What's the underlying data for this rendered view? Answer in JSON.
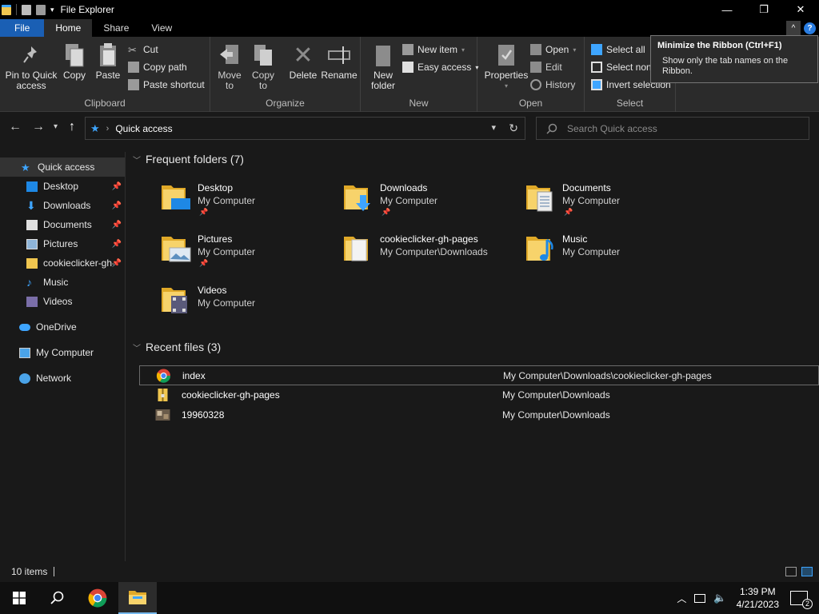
{
  "window": {
    "title": "File Explorer"
  },
  "controls": {
    "minimize": "—",
    "maximize": "❐",
    "close": "✕"
  },
  "tabs": [
    {
      "label": "File"
    },
    {
      "label": "Home"
    },
    {
      "label": "Share"
    },
    {
      "label": "View"
    }
  ],
  "ribbon": {
    "help": "?",
    "clipboard": {
      "label": "Clipboard",
      "pin": "Pin to Quick\naccess",
      "copy": "Copy",
      "paste": "Paste",
      "cut": "Cut",
      "copy_path": "Copy path",
      "paste_shortcut": "Paste shortcut"
    },
    "organize": {
      "label": "Organize",
      "move_to": "Move\nto",
      "copy_to": "Copy\nto",
      "delete": "Delete",
      "rename": "Rename"
    },
    "new": {
      "label": "New",
      "new_folder": "New\nfolder",
      "new_item": "New item",
      "easy_access": "Easy access"
    },
    "open": {
      "label": "Open",
      "properties": "Properties",
      "open": "Open",
      "edit": "Edit",
      "history": "History"
    },
    "select": {
      "label": "Select",
      "select_all": "Select all",
      "select_none": "Select non",
      "invert": "Invert selection"
    }
  },
  "tooltip": {
    "title": "Minimize the Ribbon (Ctrl+F1)",
    "body": "Show only the tab names on the Ribbon."
  },
  "address": {
    "path": "Quick access"
  },
  "search": {
    "placeholder": "Search Quick access"
  },
  "sidebar": {
    "items": [
      {
        "label": "Quick access",
        "icon": "star-icon"
      },
      {
        "label": "Desktop",
        "icon": "desktop-icon"
      },
      {
        "label": "Downloads",
        "icon": "download-icon"
      },
      {
        "label": "Documents",
        "icon": "document-icon"
      },
      {
        "label": "Pictures",
        "icon": "pictures-icon"
      },
      {
        "label": "cookieclicker-gh-pages",
        "icon": "folder-icon"
      },
      {
        "label": "Music",
        "icon": "music-icon"
      },
      {
        "label": "Videos",
        "icon": "videos-icon"
      },
      {
        "label": "OneDrive",
        "icon": "cloud-icon"
      },
      {
        "label": "My Computer",
        "icon": "computer-icon"
      },
      {
        "label": "Network",
        "icon": "network-icon"
      }
    ]
  },
  "frequent": {
    "title": "Frequent folders (7)",
    "folders": [
      {
        "name": "Desktop",
        "location": "My Computer"
      },
      {
        "name": "Downloads",
        "location": "My Computer"
      },
      {
        "name": "Documents",
        "location": "My Computer"
      },
      {
        "name": "Pictures",
        "location": "My Computer"
      },
      {
        "name": "cookieclicker-gh-pages",
        "location": "My Computer\\Downloads"
      },
      {
        "name": "Music",
        "location": "My Computer"
      },
      {
        "name": "Videos",
        "location": "My Computer"
      }
    ]
  },
  "recent": {
    "title": "Recent files (3)",
    "files": [
      {
        "name": "index",
        "location": "My Computer\\Downloads\\cookieclicker-gh-pages"
      },
      {
        "name": "cookieclicker-gh-pages",
        "location": "My Computer\\Downloads"
      },
      {
        "name": "19960328",
        "location": "My Computer\\Downloads"
      }
    ]
  },
  "status": {
    "count": "10 items"
  },
  "taskbar": {
    "time": "1:39 PM",
    "date": "4/21/2023",
    "notifications": "2"
  },
  "colors": {
    "accent": "#1a5fb4",
    "folder": "#f0c64f",
    "link": "#3ea5ff"
  }
}
